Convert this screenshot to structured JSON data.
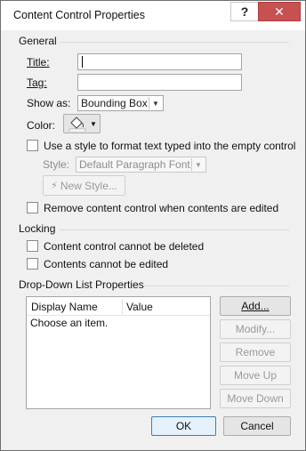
{
  "window": {
    "title": "Content Control Properties",
    "help": "?",
    "close": "✕"
  },
  "general": {
    "header": "General",
    "title_label": "Title:",
    "title_value": "",
    "tag_label": "Tag:",
    "tag_value": "",
    "show_as_label": "Show as:",
    "show_as_value": "Bounding Box",
    "color_label": "Color:",
    "use_style_label": "Use a style to format text typed into the empty control",
    "style_label": "Style:",
    "style_value": "Default Paragraph Font",
    "new_style_button": "New Style...",
    "remove_label": "Remove content control when contents are edited"
  },
  "locking": {
    "header": "Locking",
    "cannot_delete": "Content control cannot be deleted",
    "cannot_edit": "Contents cannot be edited"
  },
  "dropdown": {
    "header": "Drop-Down List Properties",
    "columns": [
      "Display Name",
      "Value"
    ],
    "rows": [
      [
        "Choose an item.",
        ""
      ]
    ],
    "buttons": {
      "add": "Add...",
      "modify": "Modify...",
      "remove": "Remove",
      "move_up": "Move Up",
      "move_down": "Move Down"
    }
  },
  "footer": {
    "ok": "OK",
    "cancel": "Cancel"
  }
}
